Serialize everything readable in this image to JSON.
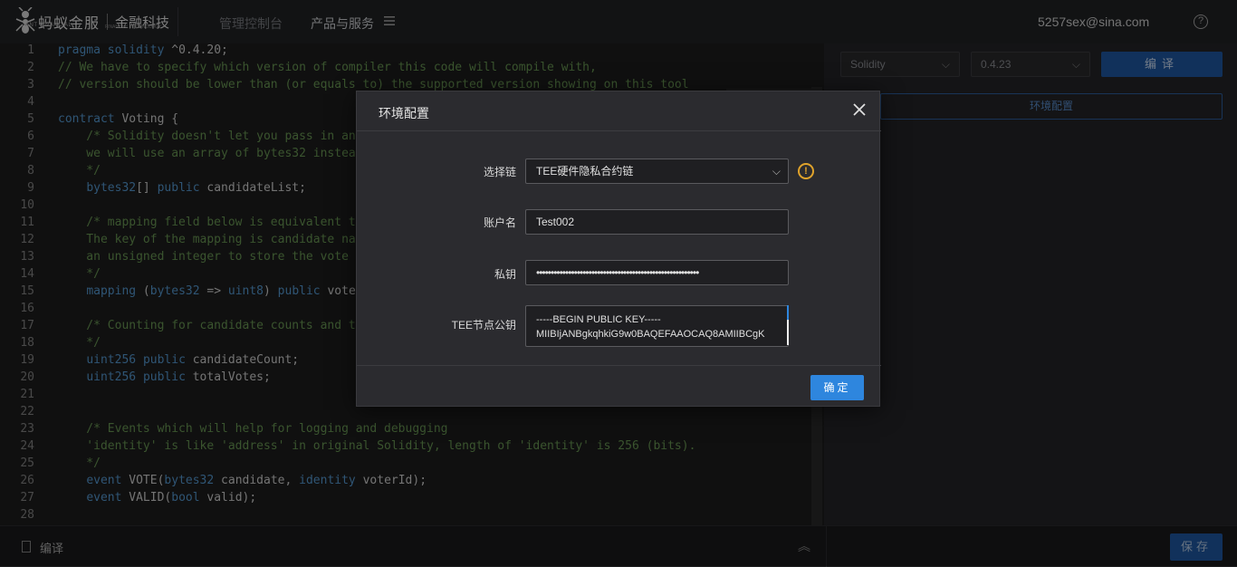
{
  "header": {
    "logo_cn": "蚂蚁金服",
    "logo_en": "ANT FINANCIAL",
    "logo_fin": "金融科技",
    "logo_fin_en": "FINANCIAL TECHNOLOGY",
    "nav_console": "管理控制台",
    "nav_products": "产品与服务",
    "email": "5257sex@sina.com",
    "help": "?"
  },
  "editor": {
    "lines": [
      {
        "n": "1",
        "t": "pragma solidity ^0.4.20;"
      },
      {
        "n": "2",
        "t": "// We have to specify which version of compiler this code will compile with,"
      },
      {
        "n": "3",
        "t": "// version should be lower than (or equals to) the supported version showing on this tool"
      },
      {
        "n": "4",
        "t": ""
      },
      {
        "n": "5",
        "t": "contract Voting {"
      },
      {
        "n": "6",
        "t": "    /* Solidity doesn't let you pass in an "
      },
      {
        "n": "7",
        "t": "    we will use an array of bytes32 instead"
      },
      {
        "n": "8",
        "t": "    */"
      },
      {
        "n": "9",
        "t": "    bytes32[] public candidateList;"
      },
      {
        "n": "10",
        "t": ""
      },
      {
        "n": "11",
        "t": "    /* mapping field below is equivalent to"
      },
      {
        "n": "12",
        "t": "    The key of the mapping is candidate nam"
      },
      {
        "n": "13",
        "t": "    an unsigned integer to store the vote c"
      },
      {
        "n": "14",
        "t": "    */"
      },
      {
        "n": "15",
        "t": "    mapping (bytes32 => uint8) public votes"
      },
      {
        "n": "16",
        "t": ""
      },
      {
        "n": "17",
        "t": "    /* Counting for candidate counts and to"
      },
      {
        "n": "18",
        "t": "    */"
      },
      {
        "n": "19",
        "t": "    uint256 public candidateCount;"
      },
      {
        "n": "20",
        "t": "    uint256 public totalVotes;"
      },
      {
        "n": "21",
        "t": ""
      },
      {
        "n": "22",
        "t": ""
      },
      {
        "n": "23",
        "t": "    /* Events which will help for logging and debugging"
      },
      {
        "n": "24",
        "t": "    'identity' is like 'address' in original Solidity, length of 'identity' is 256 (bits)."
      },
      {
        "n": "25",
        "t": "    */"
      },
      {
        "n": "26",
        "t": "    event VOTE(bytes32 candidate, identity voterId);"
      },
      {
        "n": "27",
        "t": "    event VALID(bool valid);"
      },
      {
        "n": "28",
        "t": ""
      }
    ]
  },
  "right_panel": {
    "language": "Solidity",
    "version": "0.4.23",
    "compile": "编译",
    "env_config": "环境配置"
  },
  "bottom": {
    "compile_label": "编译",
    "save": "保存"
  },
  "modal": {
    "title": "环境配置",
    "chain_label": "选择链",
    "chain_value": "TEE硬件隐私合约链",
    "account_label": "账户名",
    "account_value": "Test002",
    "key_label": "私钥",
    "key_value": "••••••••••••••••••••••••••••••••••••••••••••••••••••••••",
    "tee_label": "TEE节点公钥",
    "tee_line1": "-----BEGIN PUBLIC KEY-----",
    "tee_line2": "MIIBIjANBgkqhkiG9w0BAQEFAAOCAQ8AMIIBCgK",
    "warn": "!",
    "ok": "确定"
  },
  "colors": {
    "accent": "#2e86de",
    "warning": "#e0a32b",
    "keyword": "#569cd6",
    "comment": "#6a9955"
  }
}
